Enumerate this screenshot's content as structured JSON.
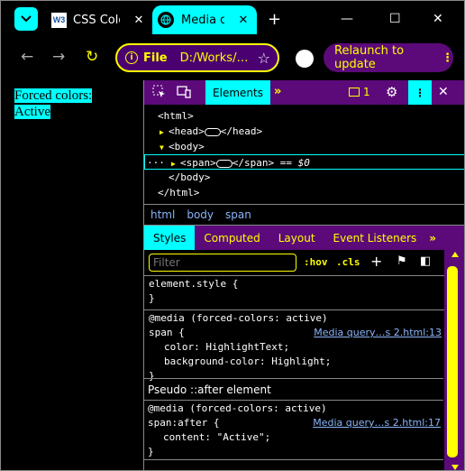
{
  "browser": {
    "tabs": [
      {
        "favicon": "W3",
        "title": "CSS Color",
        "close": "✕"
      },
      {
        "title": "Media qu",
        "close": "✕"
      }
    ],
    "new_tab": "+",
    "window_controls": {
      "minimize": "—",
      "maximize": "☐",
      "close": "✕"
    },
    "nav": {
      "back": "←",
      "forward": "→",
      "reload": "↻"
    },
    "omnibox": {
      "info": "i",
      "scheme": "File",
      "url": "D:/Works/…",
      "star": "☆"
    },
    "relaunch": {
      "label": "Relaunch to update",
      "dots": "⋮"
    }
  },
  "page": {
    "lines": [
      "Forced colors:",
      "Active"
    ]
  },
  "devtools": {
    "top": {
      "inspect_icon": "⬚",
      "device_icon": "▭",
      "elements_tab": "Elements",
      "more": "»",
      "badge_count": "1",
      "settings_icon": "⚙",
      "kebab": "⋮",
      "close": "✕"
    },
    "dom": {
      "l1": "<html>",
      "l2a": "<head>",
      "l2b": "</head>",
      "l3": "<body>",
      "dots": "···",
      "l4a": "<span>",
      "l4b": "</span>",
      "l4c": " == ",
      "l4d": "$0",
      "l5": "</body>",
      "l6": "</html>"
    },
    "breadcrumbs": [
      "html",
      "body",
      "span"
    ],
    "sub_tabs": [
      "Styles",
      "Computed",
      "Layout",
      "Event Listeners",
      "»"
    ],
    "filter": {
      "placeholder": "Filter",
      "hov": ":hov",
      "cls": ".cls",
      "plus": "+",
      "paint": "⚑",
      "sidebar": "◧"
    },
    "styles": {
      "element_style": {
        "selector": "element.style {",
        "close": "}"
      },
      "rule1": {
        "media": "@media (forced-colors: active)",
        "selector": "span {",
        "source": "Media query…s 2.html:13",
        "props": [
          "color: HighlightText;",
          "background-color: Highlight;"
        ],
        "close": "}"
      },
      "pseudo_header": "Pseudo ::after element",
      "rule2": {
        "media": "@media (forced-colors: active)",
        "selector": "span:after {",
        "source": "Media query…s 2.html:17",
        "props": [
          "content: \"Active\";"
        ],
        "close": "}"
      }
    }
  },
  "colors": {
    "accent": "#00ffff",
    "purple": "#5c0a7a",
    "yellow": "#ffff00",
    "link": "#8ab4f8"
  }
}
